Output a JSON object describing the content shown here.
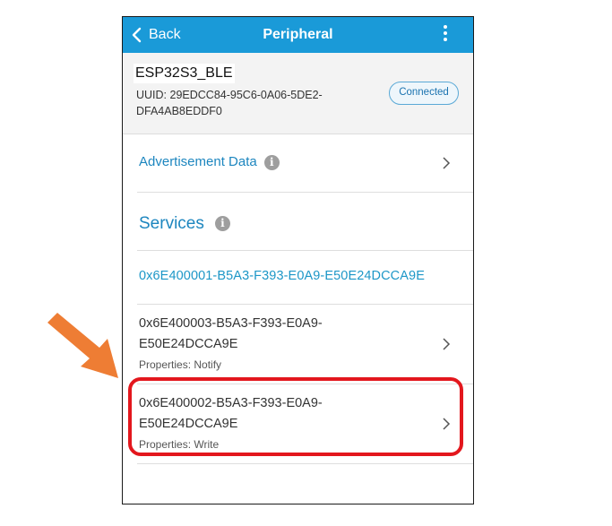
{
  "header": {
    "back_label": "Back",
    "title": "Peripheral"
  },
  "device": {
    "name": "ESP32S3_BLE",
    "uuid_line1": "UUID: 29EDCC84-95C6-0A06-5DE2-",
    "uuid_line2": "DFA4AB8EDDF0",
    "status": "Connected"
  },
  "advertisement": {
    "label": "Advertisement Data"
  },
  "services": {
    "heading": "Services",
    "service_uuid": "0x6E400001-B5A3-F393-E0A9-E50E24DCCA9E",
    "characteristics": [
      {
        "uuid_line1": "0x6E400003-B5A3-F393-E0A9-",
        "uuid_line2": "E50E24DCCA9E",
        "properties": "Properties: Notify"
      },
      {
        "uuid_line1": "0x6E400002-B5A3-F393-E0A9-",
        "uuid_line2": "E50E24DCCA9E",
        "properties": "Properties: Write"
      }
    ]
  },
  "colors": {
    "header_bg": "#1a9ad8",
    "accent_text": "#1d86bf",
    "highlight": "#e3171d",
    "arrow": "#ee7d34"
  },
  "icons": [
    "chevron-left-icon",
    "more-vertical-icon",
    "info-icon",
    "chevron-right-icon",
    "arrow-icon"
  ]
}
